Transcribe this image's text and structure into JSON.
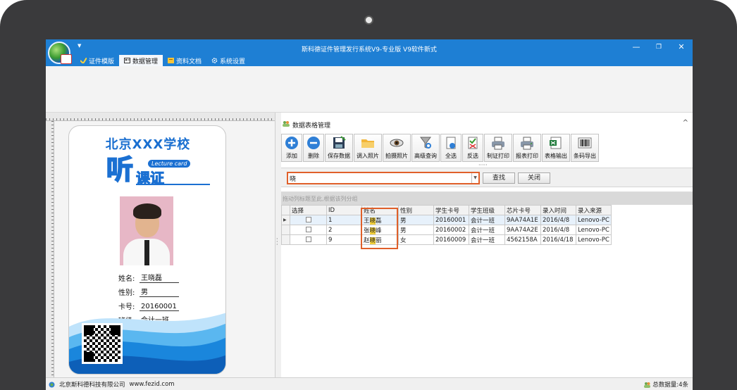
{
  "window": {
    "title": "斯科德证件管理发行系统V9-专业版   V9软件新式",
    "minimize": "—",
    "restore": "❐",
    "close": "✕"
  },
  "menu": {
    "tabs": [
      {
        "label": "证件模版",
        "icon": "card-template-icon",
        "active": false
      },
      {
        "label": "数据管理",
        "icon": "data-manage-icon",
        "active": true
      },
      {
        "label": "资料文档",
        "icon": "document-icon",
        "active": false
      },
      {
        "label": "系统设置",
        "icon": "settings-icon",
        "active": false
      }
    ]
  },
  "card": {
    "school": "北京XXX学校",
    "big_char": "听",
    "small_chars": "课证",
    "lecture": "Lecture card",
    "fields": [
      {
        "label": "姓名:",
        "value": "王晓磊"
      },
      {
        "label": "性别:",
        "value": "男"
      },
      {
        "label": "卡号:",
        "value": "20160001"
      },
      {
        "label": "班级:",
        "value": "会计一班"
      }
    ]
  },
  "panel": {
    "title": "数据表格管理",
    "collapse": "^"
  },
  "toolbar": [
    {
      "label": "添加",
      "icon": "add-icon"
    },
    {
      "label": "删除",
      "icon": "delete-icon"
    },
    {
      "label": "保存数据",
      "icon": "save-icon"
    },
    {
      "label": "调入照片",
      "icon": "folder-icon"
    },
    {
      "label": "拍摄照片",
      "icon": "camera-eye-icon"
    },
    {
      "label": "高级查询",
      "icon": "query-icon"
    },
    {
      "label": "全选",
      "icon": "select-all-icon"
    },
    {
      "label": "反选",
      "icon": "invert-select-icon"
    },
    {
      "label": "制证打印",
      "icon": "printer-icon"
    },
    {
      "label": "报表打印",
      "icon": "report-print-icon"
    },
    {
      "label": "表格输出",
      "icon": "excel-export-icon"
    },
    {
      "label": "条码导出",
      "icon": "barcode-icon"
    }
  ],
  "search": {
    "value": "晓",
    "query_label": "查找",
    "close_label": "关闭"
  },
  "grid": {
    "group_hint": "拖动列标题至此,根据该列分组",
    "columns": [
      "选择",
      "ID",
      "姓名",
      "性别",
      "学生卡号",
      "学生班级",
      "芯片卡号",
      "录入时间",
      "录入来源"
    ],
    "rows": [
      {
        "id": "1",
        "name_pre": "王",
        "name_hl": "晓",
        "name_post": "磊",
        "gender": "男",
        "card_no": "20160001",
        "class": "会计一班",
        "chip": "9AA74A1E",
        "time": "2016/4/8",
        "source": "Lenovo-PC"
      },
      {
        "id": "2",
        "name_pre": "张",
        "name_hl": "晓",
        "name_post": "峰",
        "gender": "男",
        "card_no": "20160002",
        "class": "会计一班",
        "chip": "9AA74A2E",
        "time": "2016/4/8",
        "source": "Lenovo-PC"
      },
      {
        "id": "9",
        "name_pre": "赵",
        "name_hl": "晓",
        "name_post": "丽",
        "gender": "女",
        "card_no": "20160009",
        "class": "会计一班",
        "chip": "4562158A",
        "time": "2016/4/18",
        "source": "Lenovo-PC"
      }
    ]
  },
  "status": {
    "company": "北京斯科德科技有限公司",
    "website": "www.fezid.com",
    "total": "总数据量:4条"
  },
  "colors": {
    "titlebar": "#1e7fd4",
    "highlight_frame": "#e0602a",
    "match_highlight": "#f5d23c"
  }
}
